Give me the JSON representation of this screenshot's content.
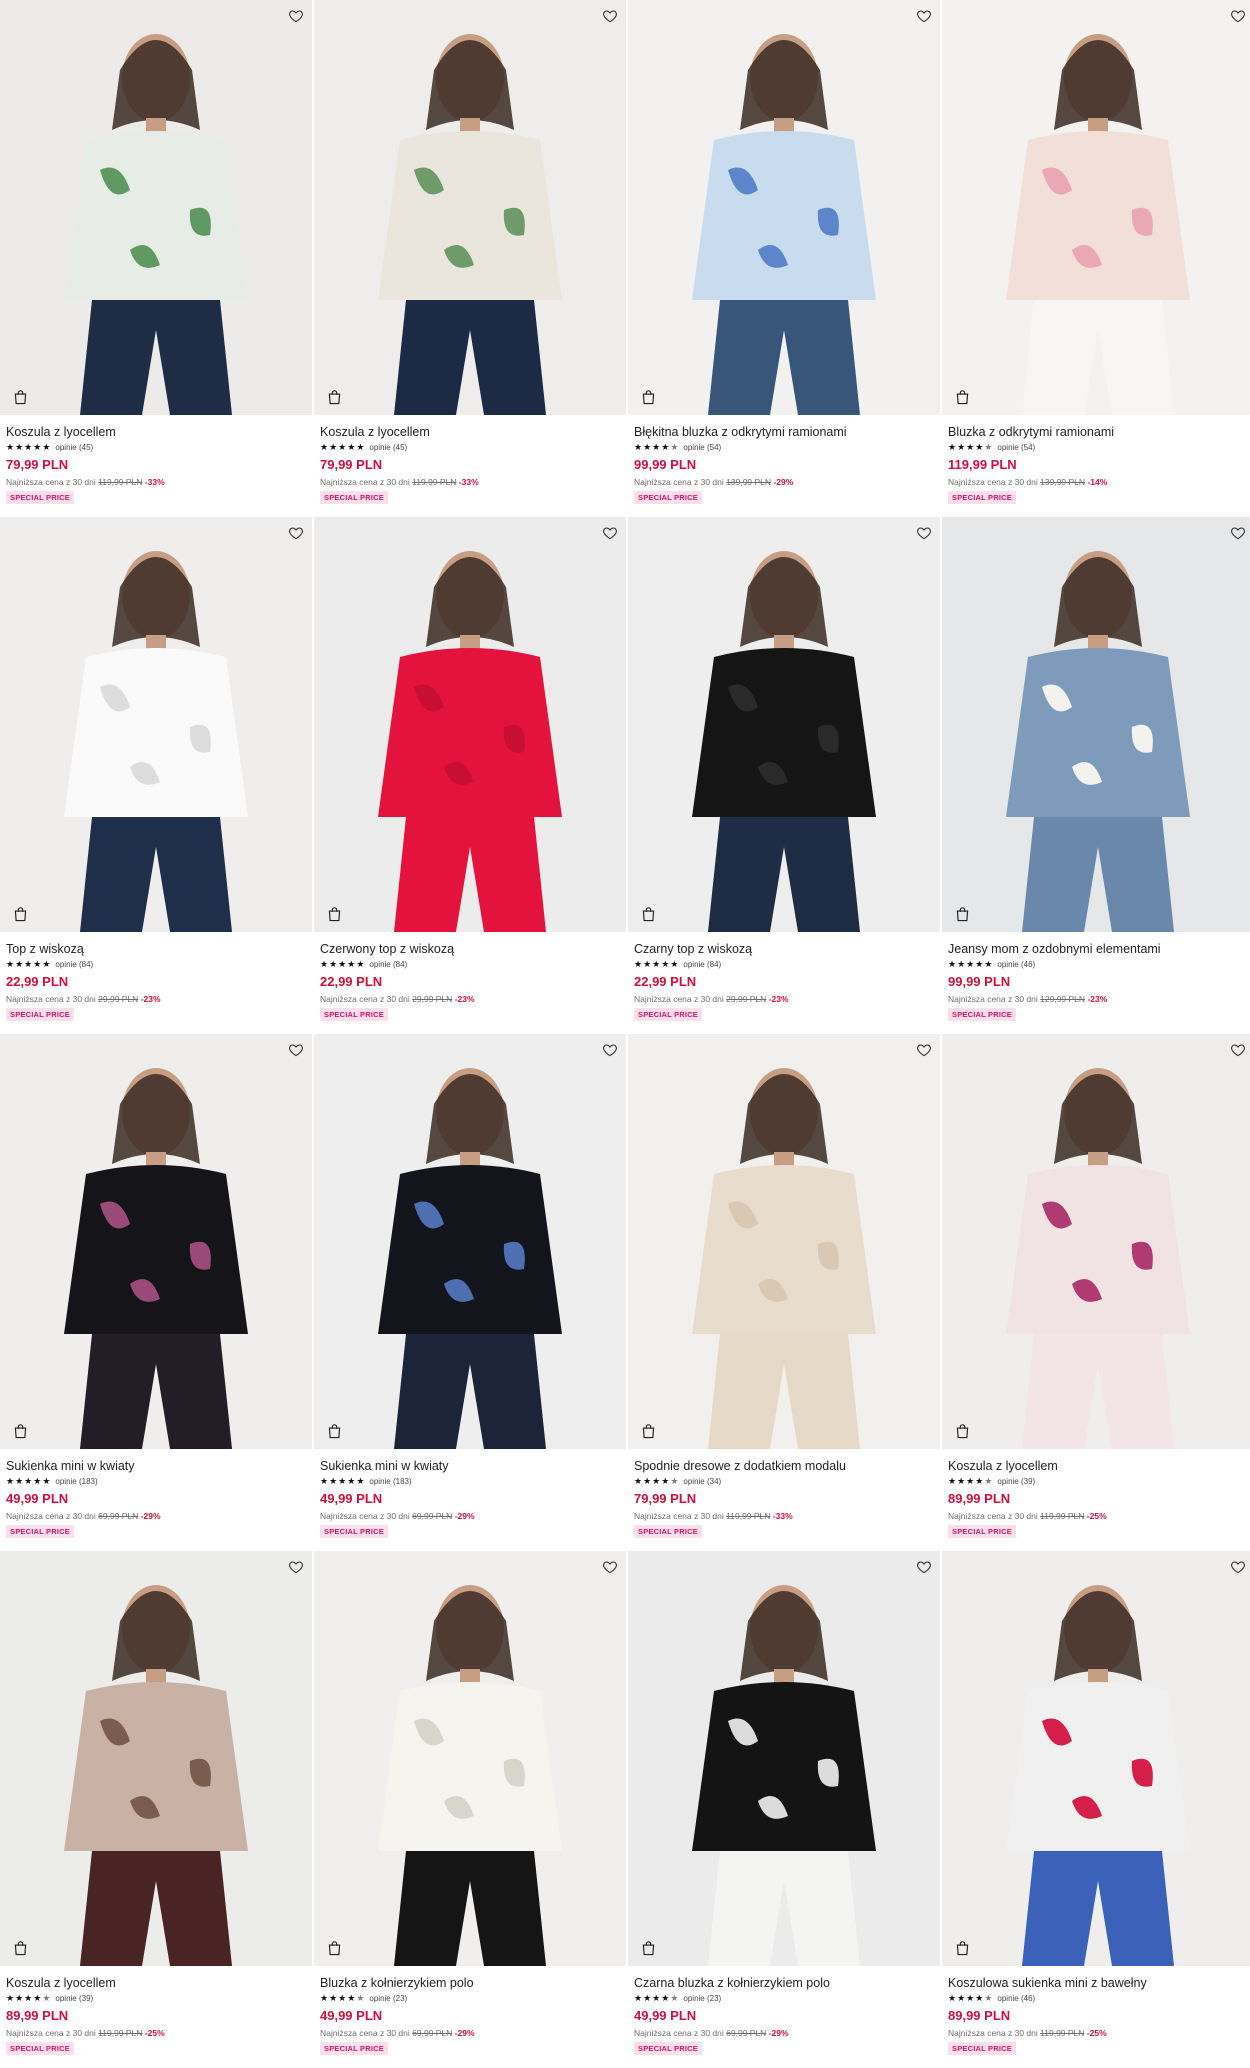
{
  "labels": {
    "special_price": "SPECIAL PRICE",
    "lowest_prefix": "Najniższa cena z 30 dni",
    "reviews_prefix": "opinie"
  },
  "icons": {
    "favorite": "heart-outline-icon",
    "cart": "shopping-bag-icon",
    "star": "star-icon"
  },
  "colors": {
    "price": "#d0103a",
    "badge_bg": "#fbe0ec",
    "badge_text": "#d1136a"
  },
  "products": [
    {
      "name": "Koszula z lyocellem",
      "rating": 5,
      "reviews": "(45)",
      "price": "79,99 PLN",
      "lowest_price": "119,99 PLN",
      "discount": "-33%",
      "bg": "#ecebea",
      "top": "#e8ece6",
      "accent": "#5f9a63",
      "bottom": "#1f2c46"
    },
    {
      "name": "Koszula z lyocellem",
      "rating": 5,
      "reviews": "(45)",
      "price": "79,99 PLN",
      "lowest_price": "119,99 PLN",
      "discount": "-33%",
      "bg": "#efedec",
      "top": "#eae6de",
      "accent": "#6f9a6a",
      "bottom": "#1d2a45"
    },
    {
      "name": "Błękitna bluzka z odkrytymi ramionami",
      "rating": 4.5,
      "reviews": "(54)",
      "price": "99,99 PLN",
      "lowest_price": "139,99 PLN",
      "discount": "-29%",
      "bg": "#f2f1f0",
      "top": "#c9dbef",
      "accent": "#5c86c9",
      "bottom": "#38557a"
    },
    {
      "name": "Bluzka z odkrytymi ramionami",
      "rating": 4.5,
      "reviews": "(54)",
      "price": "119,99 PLN",
      "lowest_price": "139,99 PLN",
      "discount": "-14%",
      "bg": "#f3f2f1",
      "top": "#f1dfd8",
      "accent": "#e9a8b4",
      "bottom": "#f7f6f4"
    },
    {
      "name": "Top z wiskozą",
      "rating": 5,
      "reviews": "(84)",
      "price": "22,99 PLN",
      "lowest_price": "29,99 PLN",
      "discount": "-23%",
      "bg": "#efeeed",
      "top": "#fafafa",
      "accent": "#dddddd",
      "bottom": "#1f2e4a"
    },
    {
      "name": "Czerwony top z wiskozą",
      "rating": 5,
      "reviews": "(84)",
      "price": "22,99 PLN",
      "lowest_price": "29,99 PLN",
      "discount": "-23%",
      "bg": "#edecec",
      "top": "#e3133d",
      "accent": "#c80f33",
      "bottom": "#e3133d"
    },
    {
      "name": "Czarny top z wiskozą",
      "rating": 5,
      "reviews": "(84)",
      "price": "22,99 PLN",
      "lowest_price": "29,99 PLN",
      "discount": "-23%",
      "bg": "#efeeee",
      "top": "#151515",
      "accent": "#2a2a2a",
      "bottom": "#1f2c45"
    },
    {
      "name": "Jeansy mom z ozdobnymi elementami",
      "rating": 5,
      "reviews": "(46)",
      "price": "99,99 PLN",
      "lowest_price": "129,99 PLN",
      "discount": "-23%",
      "bg": "#e6e7e9",
      "top": "#7e9bbb",
      "accent": "#f4f2ef",
      "bottom": "#6a88ab"
    },
    {
      "name": "Sukienka mini w kwiaty",
      "rating": 5,
      "reviews": "(183)",
      "price": "49,99 PLN",
      "lowest_price": "69,99 PLN",
      "discount": "-29%",
      "bg": "#efeeed",
      "top": "#151419",
      "accent": "#9a4a79",
      "bottom": "#231d27"
    },
    {
      "name": "Sukienka mini w kwiaty",
      "rating": 5,
      "reviews": "(183)",
      "price": "49,99 PLN",
      "lowest_price": "69,99 PLN",
      "discount": "-29%",
      "bg": "#efeeee",
      "top": "#14151c",
      "accent": "#4f6fb3",
      "bottom": "#1d2338"
    },
    {
      "name": "Spodnie dresowe z dodatkiem modalu",
      "rating": 4.5,
      "reviews": "(34)",
      "price": "79,99 PLN",
      "lowest_price": "119,99 PLN",
      "discount": "-33%",
      "bg": "#f1f0ef",
      "top": "#e8dccd",
      "accent": "#d9c8b3",
      "bottom": "#e6d9c8"
    },
    {
      "name": "Koszula z lyocellem",
      "rating": 4.5,
      "reviews": "(39)",
      "price": "89,99 PLN",
      "lowest_price": "119,99 PLN",
      "discount": "-25%",
      "bg": "#efeeed",
      "top": "#f1e2e4",
      "accent": "#b03a72",
      "bottom": "#f2e4e7"
    },
    {
      "name": "Koszula z lyocellem",
      "rating": 4.5,
      "reviews": "(39)",
      "price": "89,99 PLN",
      "lowest_price": "119,99 PLN",
      "discount": "-25%",
      "bg": "#ececeb",
      "top": "#c9b1a6",
      "accent": "#7b5d4f",
      "bottom": "#4a2324"
    },
    {
      "name": "Bluzka z kołnierzykiem polo",
      "rating": 4.5,
      "reviews": "(23)",
      "price": "49,99 PLN",
      "lowest_price": "69,99 PLN",
      "discount": "-29%",
      "bg": "#f0efee",
      "top": "#f6f4ef",
      "accent": "#d8d5cc",
      "bottom": "#151515"
    },
    {
      "name": "Czarna bluzka z kołnierzykiem polo",
      "rating": 4.5,
      "reviews": "(23)",
      "price": "49,99 PLN",
      "lowest_price": "69,99 PLN",
      "discount": "-29%",
      "bg": "#ebebeb",
      "top": "#141414",
      "accent": "#dcdcdc",
      "bottom": "#f4f4f2"
    },
    {
      "name": "Koszulowa sukienka mini z bawełny",
      "rating": 4.5,
      "reviews": "(46)",
      "price": "89,99 PLN",
      "lowest_price": "119,99 PLN",
      "discount": "-25%",
      "bg": "#efeeed",
      "top": "#f0f0f0",
      "accent": "#d51f4a",
      "bottom": "#3b62b8"
    }
  ]
}
